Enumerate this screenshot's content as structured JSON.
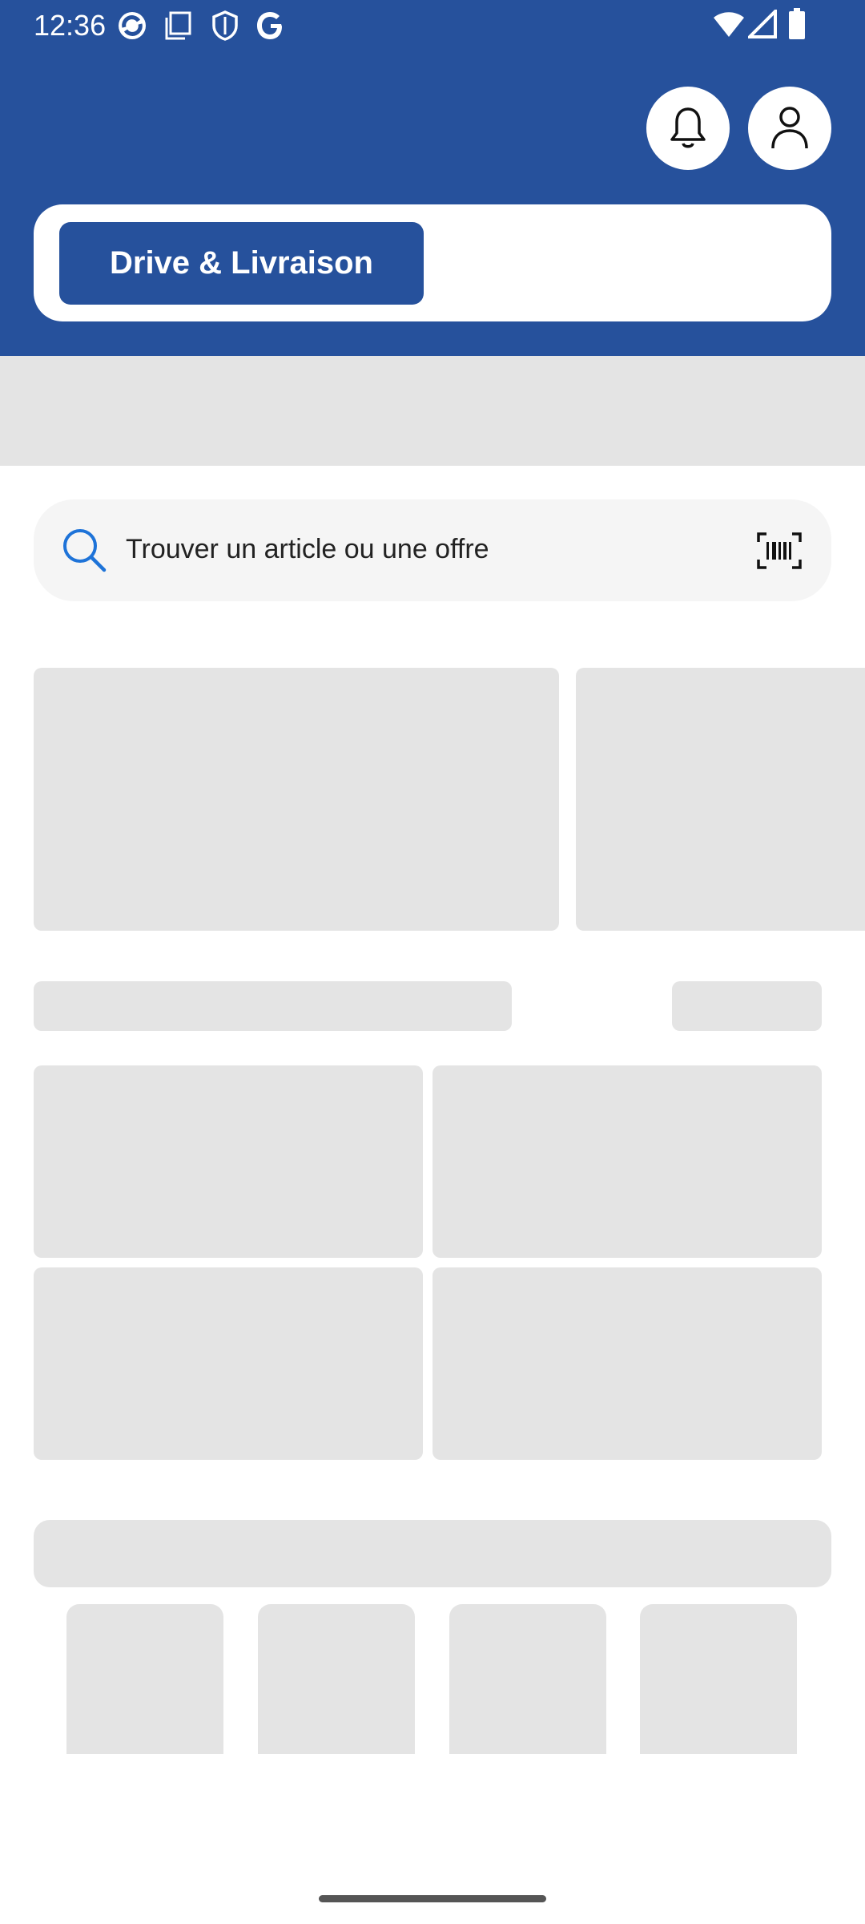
{
  "status_bar": {
    "time": "12:36"
  },
  "header": {
    "mode_button_label": "Drive & Livraison"
  },
  "search": {
    "placeholder": "Trouver un article ou une offre"
  },
  "colors": {
    "brand": "#26519c",
    "skeleton": "#e4e4e4",
    "search_icon": "#1e73d8"
  },
  "icons": [
    "bell-icon",
    "user-icon",
    "search-icon",
    "barcode-scan-icon"
  ]
}
